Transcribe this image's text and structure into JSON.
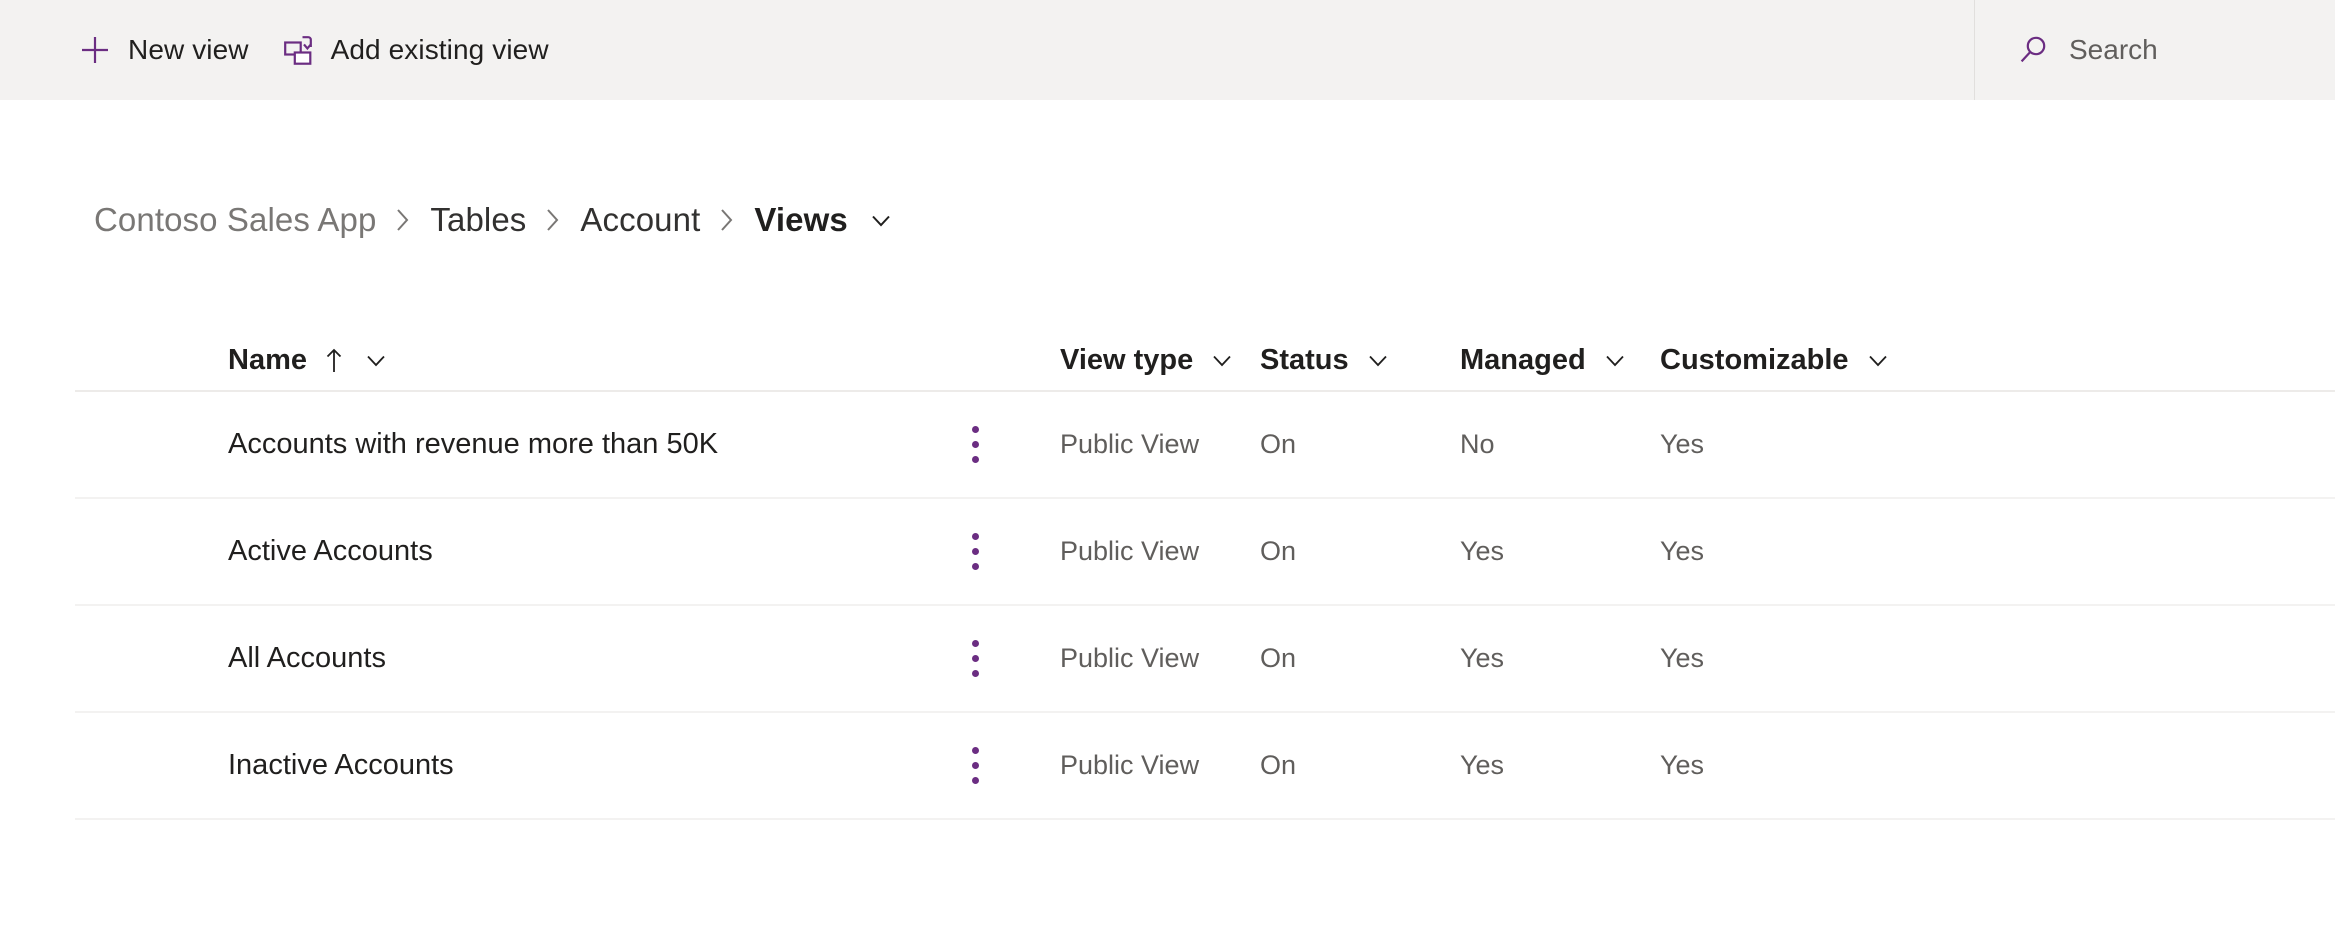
{
  "commandbar": {
    "buttons": [
      {
        "icon": "plus-icon",
        "label": "New view"
      },
      {
        "icon": "add-existing-view-icon",
        "label": "Add existing view"
      }
    ],
    "search": {
      "icon": "search-icon",
      "placeholder": "Search",
      "value": ""
    }
  },
  "breadcrumb": {
    "items": [
      {
        "label": "Contoso Sales App",
        "current": false
      },
      {
        "label": "Tables",
        "current": false
      },
      {
        "label": "Account",
        "current": false
      },
      {
        "label": "Views",
        "current": true
      }
    ],
    "separator": "›",
    "caret_icon": "chevron-down-icon"
  },
  "grid": {
    "columns": [
      {
        "key": "name",
        "label": "Name",
        "sort": "ascending",
        "sort_icon": "arrow-up-icon",
        "caret_icon": "chevron-down-icon"
      },
      {
        "key": "viewtype",
        "label": "View type",
        "sort": null,
        "caret_icon": "chevron-down-icon"
      },
      {
        "key": "status",
        "label": "Status",
        "sort": null,
        "caret_icon": "chevron-down-icon"
      },
      {
        "key": "managed",
        "label": "Managed",
        "sort": null,
        "caret_icon": "chevron-down-icon"
      },
      {
        "key": "customizable",
        "label": "Customizable",
        "sort": null,
        "caret_icon": "chevron-down-icon"
      }
    ],
    "row_menu_icon": "more-vertical-icon",
    "rows": [
      {
        "name": "Accounts with revenue more than 50K",
        "viewtype": "Public View",
        "status": "On",
        "managed": "No",
        "customizable": "Yes"
      },
      {
        "name": "Active Accounts",
        "viewtype": "Public View",
        "status": "On",
        "managed": "Yes",
        "customizable": "Yes"
      },
      {
        "name": "All Accounts",
        "viewtype": "Public View",
        "status": "On",
        "managed": "Yes",
        "customizable": "Yes"
      },
      {
        "name": "Inactive Accounts",
        "viewtype": "Public View",
        "status": "On",
        "managed": "Yes",
        "customizable": "Yes"
      }
    ]
  },
  "colors": {
    "accent": "#6b2d82",
    "commandbar_bg": "#f3f2f1",
    "text_primary": "#201f1e",
    "text_secondary": "#605e5c",
    "row_divider": "#f3f2f1"
  }
}
